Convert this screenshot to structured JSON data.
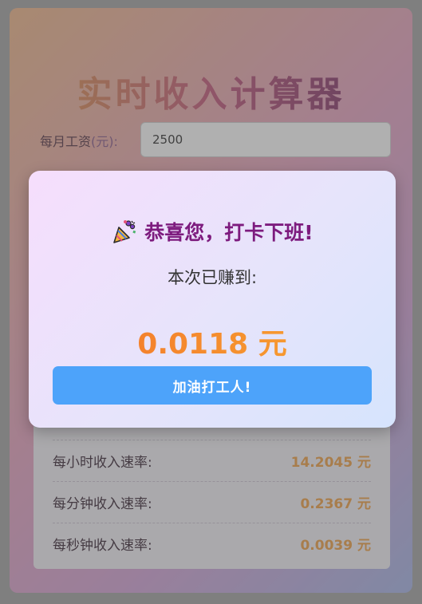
{
  "app": {
    "title": "实时收入计算器",
    "salary_label": "每月工资",
    "salary_unit": "(元):",
    "salary_value": "2500"
  },
  "rates": [
    {
      "label": "每小时收入速率:",
      "value": "14.2045 元"
    },
    {
      "label": "每分钟收入速率:",
      "value": "0.2367 元"
    },
    {
      "label": "每秒钟收入速率:",
      "value": "0.0039 元"
    }
  ],
  "modal": {
    "title": "恭喜您，打卡下班!",
    "earned_label": "本次已赚到:",
    "amount": "0.0118 元",
    "button_label": "加油打工人!",
    "icon": "party-popper-icon"
  },
  "colors": {
    "title_purple": "#7d1b7e",
    "amount_orange": "#f3722a",
    "button_blue": "#4da3fa",
    "rate_value": "#f0a34a"
  }
}
